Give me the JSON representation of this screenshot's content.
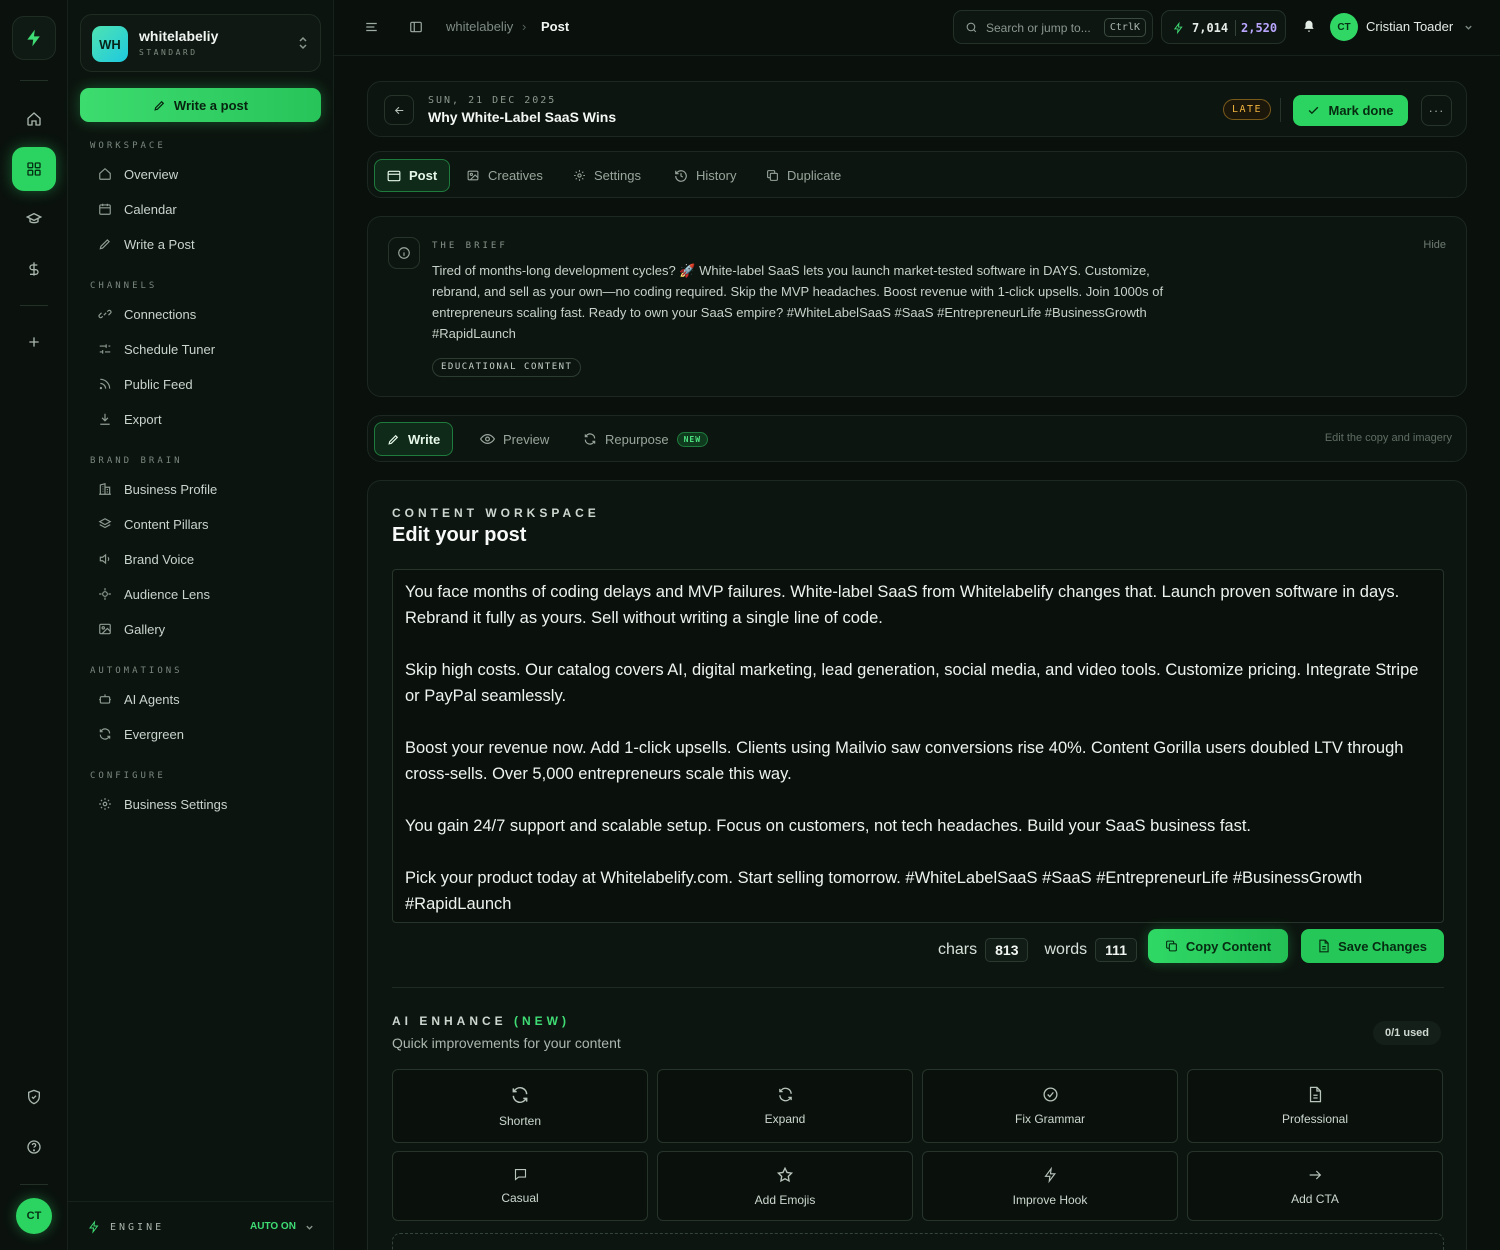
{
  "workspace": {
    "initials": "WH",
    "name": "whitelabeliy",
    "plan": "STANDARD"
  },
  "sidebar": {
    "write_post": "Write a post",
    "sections": {
      "workspace": "WORKSPACE",
      "channels": "CHANNELS",
      "brand_brain": "BRAND BRAIN",
      "automations": "AUTOMATIONS",
      "configure": "CONFIGURE"
    },
    "items": {
      "overview": "Overview",
      "calendar": "Calendar",
      "write_a_post": "Write a Post",
      "connections": "Connections",
      "schedule_tuner": "Schedule Tuner",
      "public_feed": "Public Feed",
      "export": "Export",
      "business_profile": "Business Profile",
      "content_pillars": "Content Pillars",
      "brand_voice": "Brand Voice",
      "audience_lens": "Audience Lens",
      "gallery": "Gallery",
      "ai_agents": "AI Agents",
      "evergreen": "Evergreen",
      "business_settings": "Business Settings"
    },
    "engine_label": "ENGINE",
    "engine_status": "AUTO ON"
  },
  "rail": {
    "avatar": "CT"
  },
  "topbar": {
    "breadcrumb_workspace": "whitelabeliy",
    "breadcrumb_sep": "›",
    "breadcrumb_page": "Post",
    "search_placeholder": "Search or jump to...",
    "search_shortcut": "CtrlK",
    "credits_primary": "7,014",
    "credits_secondary": "2,520",
    "user_initials": "CT",
    "user_name": "Cristian Toader"
  },
  "post": {
    "date": "SUN, 21 DEC 2025",
    "title": "Why White-Label SaaS Wins",
    "status_badge": "LATE",
    "mark_done": "Mark done",
    "more": "···"
  },
  "post_tabs": {
    "post": "Post",
    "creatives": "Creatives",
    "settings": "Settings",
    "history": "History",
    "duplicate": "Duplicate"
  },
  "brief": {
    "label": "THE BRIEF",
    "hide": "Hide",
    "text": "Tired of months-long development cycles? 🚀 White-label SaaS lets you launch market-tested software in DAYS. Customize, rebrand, and sell as your own—no coding required. Skip the MVP headaches. Boost revenue with 1-click upsells. Join 1000s of entrepreneurs scaling fast. Ready to own your SaaS empire? #WhiteLabelSaaS #SaaS #EntrepreneurLife #BusinessGrowth #RapidLaunch",
    "tag": "EDUCATIONAL CONTENT"
  },
  "mode_tabs": {
    "write": "Write",
    "preview": "Preview",
    "repurpose": "Repurpose",
    "new_badge": "NEW",
    "hint": "Edit the copy and imagery"
  },
  "content": {
    "label": "CONTENT WORKSPACE",
    "title": "Edit your post",
    "paragraphs": [
      "You face months of coding delays and MVP failures. White-label SaaS from Whitelabelify changes that. Launch proven software in days. Rebrand it fully as yours. Sell without writing a single line of code.",
      "Skip high costs. Our catalog covers AI, digital marketing, lead generation, social media, and video tools. Customize pricing. Integrate Stripe or PayPal seamlessly.",
      "Boost your revenue now. Add 1-click upsells. Clients using Mailvio saw conversions rise 40%. Content Gorilla users doubled LTV through cross-sells. Over 5,000 entrepreneurs scale this way.",
      "You gain 24/7 support and scalable setup. Focus on customers, not tech headaches. Build your SaaS business fast.",
      "Pick your product today at Whitelabelify.com. Start selling tomorrow. #WhiteLabelSaaS #SaaS #EntrepreneurLife #BusinessGrowth #RapidLaunch"
    ],
    "chars_label": "chars",
    "chars_value": "813",
    "words_label": "words",
    "words_value": "111",
    "copy_button": "Copy Content",
    "save_button": "Save Changes"
  },
  "ai": {
    "label": "AI ENHANCE",
    "label_new": "(NEW)",
    "subtitle": "Quick improvements for your content",
    "usage": "0/1 used",
    "actions": [
      "Shorten",
      "Expand",
      "Fix Grammar",
      "Professional",
      "Casual",
      "Add Emojis",
      "Improve Hook",
      "Add CTA"
    ]
  },
  "colors": {
    "accent": "#2bd460",
    "late": "#f0b43d",
    "credits_secondary": "#b9a6ff",
    "background": "#0a100c"
  }
}
